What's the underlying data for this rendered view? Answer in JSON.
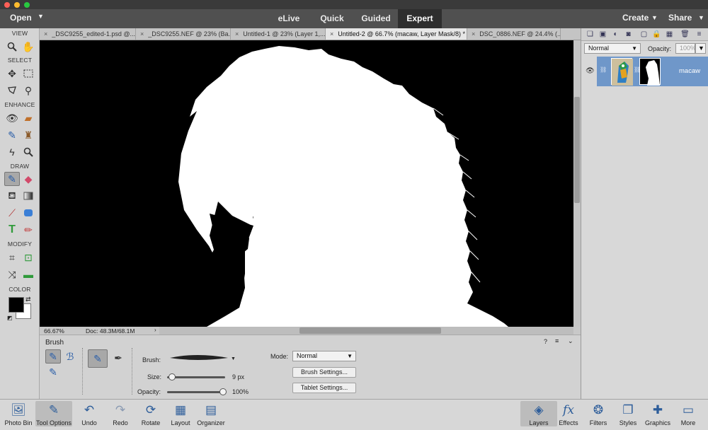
{
  "top": {
    "open_label": "Open",
    "modes": [
      "eLive",
      "Quick",
      "Guided",
      "Expert"
    ],
    "active_mode": "Expert",
    "create_label": "Create",
    "share_label": "Share"
  },
  "toolbox": {
    "sections": [
      "VIEW",
      "SELECT",
      "ENHANCE",
      "DRAW",
      "MODIFY",
      "COLOR"
    ],
    "tools": {
      "zoom": "zoom-icon",
      "hand": "hand-icon",
      "move": "move-icon",
      "marquee": "marquee-icon",
      "lasso": "lasso-icon",
      "quick_select": "quick-selection-icon",
      "red_eye": "red-eye-icon",
      "spot_heal": "spot-healing-icon",
      "smart_brush": "smart-brush-icon",
      "clone": "clone-stamp-icon",
      "blur": "blur-icon",
      "sponge": "sponge-icon",
      "brush": "brush-icon",
      "eraser": "eraser-icon",
      "paint_bucket": "paint-bucket-icon",
      "gradient": "gradient-icon",
      "eyedropper": "eyedropper-icon",
      "shape": "shape-icon",
      "type": "type-icon",
      "pencil": "pencil-icon",
      "crop": "crop-icon",
      "recompose": "recompose-icon",
      "content_move": "content-aware-move-icon",
      "straighten": "straighten-icon"
    },
    "colors": {
      "foreground": "#000000",
      "background": "#ffffff"
    }
  },
  "tabs": [
    "_DSC9255_edited-1.psd @...",
    "_DSC9255.NEF @ 23% (Ba...",
    "Untitled-1 @ 23% (Layer 1,...",
    "Untitled-2 @ 66.7% (macaw, Layer Mask/8) *",
    "DSC_0886.NEF @ 24.4% (..."
  ],
  "active_tab_index": 3,
  "tab_close_glyph": "×",
  "status": {
    "zoom": "66.67%",
    "doc": "Doc: 48.3M/68.1M"
  },
  "options": {
    "tool_name": "Brush",
    "brush_label": "Brush:",
    "size_label": "Size:",
    "size_value": "9 px",
    "size_fraction": 0.05,
    "opacity_label": "Opacity:",
    "opacity_value": "100%",
    "opacity_fraction": 1.0,
    "mode_label": "Mode:",
    "mode_value": "Normal",
    "brush_settings_label": "Brush Settings...",
    "tablet_settings_label": "Tablet Settings..."
  },
  "layers_panel": {
    "blend_mode": "Normal",
    "opacity_label": "Opacity:",
    "opacity_value": "100%",
    "layer_name": "macaw"
  },
  "taskbar": {
    "left": [
      {
        "label": "Photo Bin",
        "icon": "photo-bin-icon"
      },
      {
        "label": "Tool Options",
        "icon": "tool-options-icon"
      },
      {
        "label": "Undo",
        "icon": "undo-icon"
      },
      {
        "label": "Redo",
        "icon": "redo-icon"
      },
      {
        "label": "Rotate",
        "icon": "rotate-icon"
      },
      {
        "label": "Layout",
        "icon": "layout-icon"
      },
      {
        "label": "Organizer",
        "icon": "organizer-icon"
      }
    ],
    "right": [
      {
        "label": "Layers",
        "icon": "layers-icon"
      },
      {
        "label": "Effects",
        "icon": "effects-icon"
      },
      {
        "label": "Filters",
        "icon": "filters-icon"
      },
      {
        "label": "Styles",
        "icon": "styles-icon"
      },
      {
        "label": "Graphics",
        "icon": "graphics-icon"
      },
      {
        "label": "More",
        "icon": "more-icon"
      }
    ]
  }
}
